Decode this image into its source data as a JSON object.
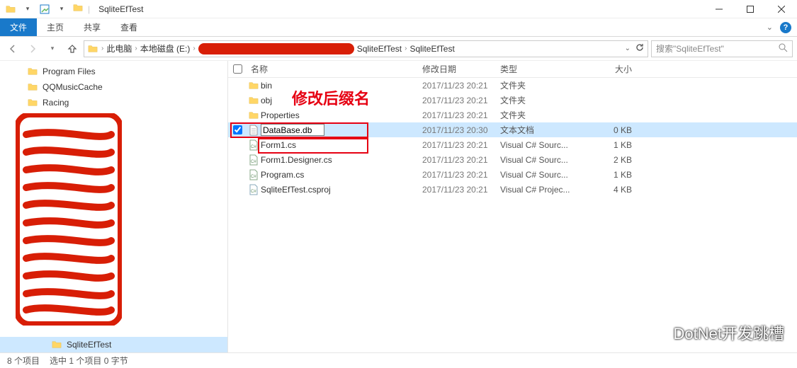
{
  "window": {
    "title": "SqliteEfTest"
  },
  "ribbon": {
    "file": "文件",
    "tabs": [
      "主页",
      "共享",
      "查看"
    ]
  },
  "breadcrumb": {
    "root": "此电脑",
    "drive": "本地磁盘 (E:)",
    "folder1": "SqliteEfTest",
    "folder2": "SqliteEfTest"
  },
  "search": {
    "placeholder": "搜索\"SqliteEfTest\""
  },
  "sidebar": {
    "items": [
      {
        "label": "Program Files"
      },
      {
        "label": "QQMusicCache"
      },
      {
        "label": "Racing"
      }
    ],
    "selected": "SqliteEfTest"
  },
  "columns": {
    "name": "名称",
    "date": "修改日期",
    "type": "类型",
    "size": "大小"
  },
  "rows": [
    {
      "icon": "folder",
      "name": "bin",
      "date": "2017/11/23 20:21",
      "type": "文件夹",
      "size": ""
    },
    {
      "icon": "folder",
      "name": "obj",
      "date": "2017/11/23 20:21",
      "type": "文件夹",
      "size": ""
    },
    {
      "icon": "folder",
      "name": "Properties",
      "date": "2017/11/23 20:21",
      "type": "文件夹",
      "size": ""
    },
    {
      "icon": "text",
      "name": "DataBase.db",
      "date": "2017/11/23 20:30",
      "type": "文本文档",
      "size": "0 KB",
      "selected": true,
      "rename": true,
      "checked": true
    },
    {
      "icon": "cs",
      "name": "Form1.cs",
      "date": "2017/11/23 20:21",
      "type": "Visual C# Sourc...",
      "size": "1 KB"
    },
    {
      "icon": "cs",
      "name": "Form1.Designer.cs",
      "date": "2017/11/23 20:21",
      "type": "Visual C# Sourc...",
      "size": "2 KB"
    },
    {
      "icon": "cs",
      "name": "Program.cs",
      "date": "2017/11/23 20:21",
      "type": "Visual C# Sourc...",
      "size": "1 KB"
    },
    {
      "icon": "csproj",
      "name": "SqliteEfTest.csproj",
      "date": "2017/11/23 20:21",
      "type": "Visual C# Projec...",
      "size": "4 KB"
    }
  ],
  "annotation": "修改后缀名",
  "status": {
    "count": "8 个项目",
    "selection": "选中 1 个项目 0 字节"
  },
  "watermark": "DotNet开发跳槽"
}
